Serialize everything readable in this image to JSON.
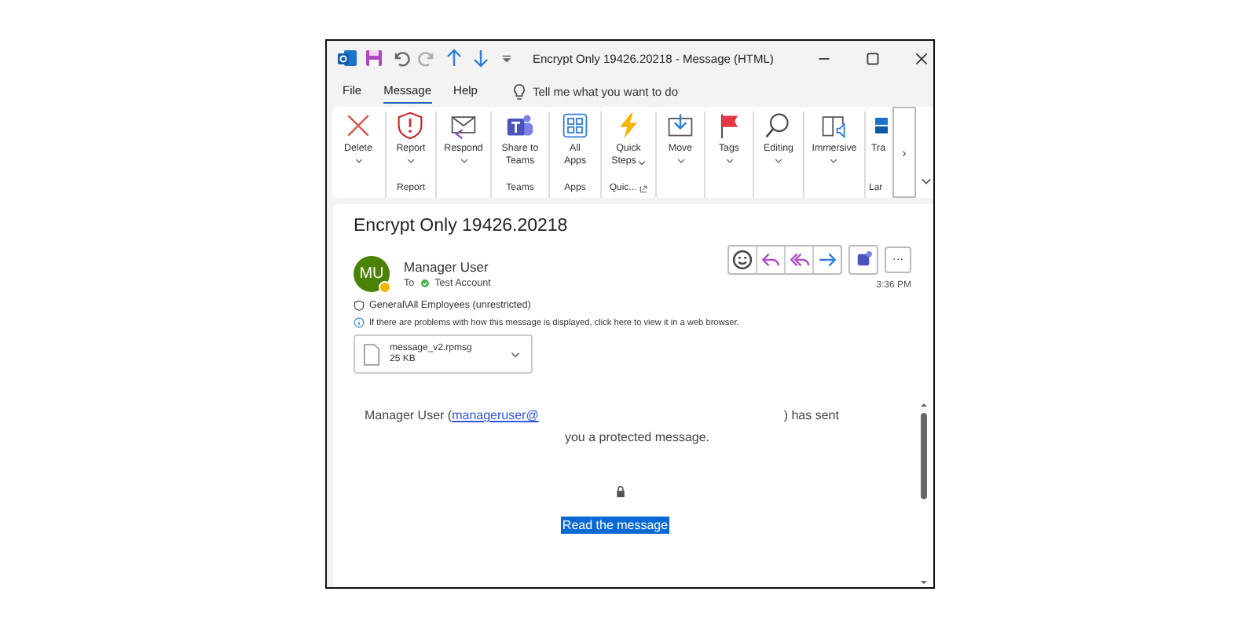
{
  "window": {
    "title": "Encrypt Only 19426.20218  -  Message (HTML)"
  },
  "menu_tabs": [
    {
      "label": "File",
      "selected": false
    },
    {
      "label": "Message",
      "selected": true
    },
    {
      "label": "Help",
      "selected": false
    }
  ],
  "search": {
    "placeholder": "Tell me what you want to do"
  },
  "ribbon_groups": [
    {
      "buttons": [
        {
          "kind": "delete",
          "lines": [
            "Delete"
          ],
          "dropdown": true
        }
      ]
    },
    {
      "label": "Report",
      "buttons": [
        {
          "kind": "report",
          "lines": [
            "Report"
          ],
          "dropdown": true
        }
      ]
    },
    {
      "buttons": [
        {
          "kind": "respond",
          "lines": [
            "Respond"
          ],
          "dropdown": true
        }
      ]
    },
    {
      "label": "Teams",
      "buttons": [
        {
          "kind": "teams",
          "lines": [
            "Share to",
            "Teams"
          ],
          "dropdown": false
        }
      ]
    },
    {
      "label": "Apps",
      "buttons": [
        {
          "kind": "apps",
          "lines": [
            "All",
            "Apps"
          ],
          "dropdown": false
        }
      ]
    },
    {
      "label": "Quic...",
      "launcher": true,
      "buttons": [
        {
          "kind": "quicksteps",
          "lines": [
            "Quick",
            "Steps"
          ],
          "dropdown": true
        }
      ]
    },
    {
      "buttons": [
        {
          "kind": "move",
          "lines": [
            "Move"
          ],
          "dropdown": true
        }
      ]
    },
    {
      "buttons": [
        {
          "kind": "tags",
          "lines": [
            "Tags"
          ],
          "dropdown": true
        }
      ]
    },
    {
      "buttons": [
        {
          "kind": "editing",
          "lines": [
            "Editing"
          ],
          "dropdown": true
        }
      ]
    },
    {
      "buttons": [
        {
          "kind": "immersive",
          "lines": [
            "Immersive"
          ],
          "dropdown": true
        }
      ]
    },
    {
      "label": "Lar",
      "buttons": [
        {
          "kind": "translate",
          "lines": [
            "Tra"
          ],
          "dropdown": false
        }
      ]
    }
  ],
  "ribbon_scroll": "›",
  "message": {
    "subject": "Encrypt Only 19426.20218",
    "sender": {
      "initials": "MU",
      "name": "Manager User"
    },
    "to_label": "To",
    "recipient": "Test Account",
    "time": "3:36 PM",
    "more_label": "···",
    "sensitivity": "General\\All Employees (unrestricted)",
    "info": "If there are problems with how this message is displayed, click here to view it in a web browser.",
    "attachment": {
      "name": "message_v2.rpmsg",
      "size": "25 KB"
    },
    "body": {
      "before": "Manager User (",
      "link": "manageruser@",
      "after": ") has sent",
      "line2": "you a protected message.",
      "action": "Read the message",
      "action_highlighted": true
    }
  }
}
